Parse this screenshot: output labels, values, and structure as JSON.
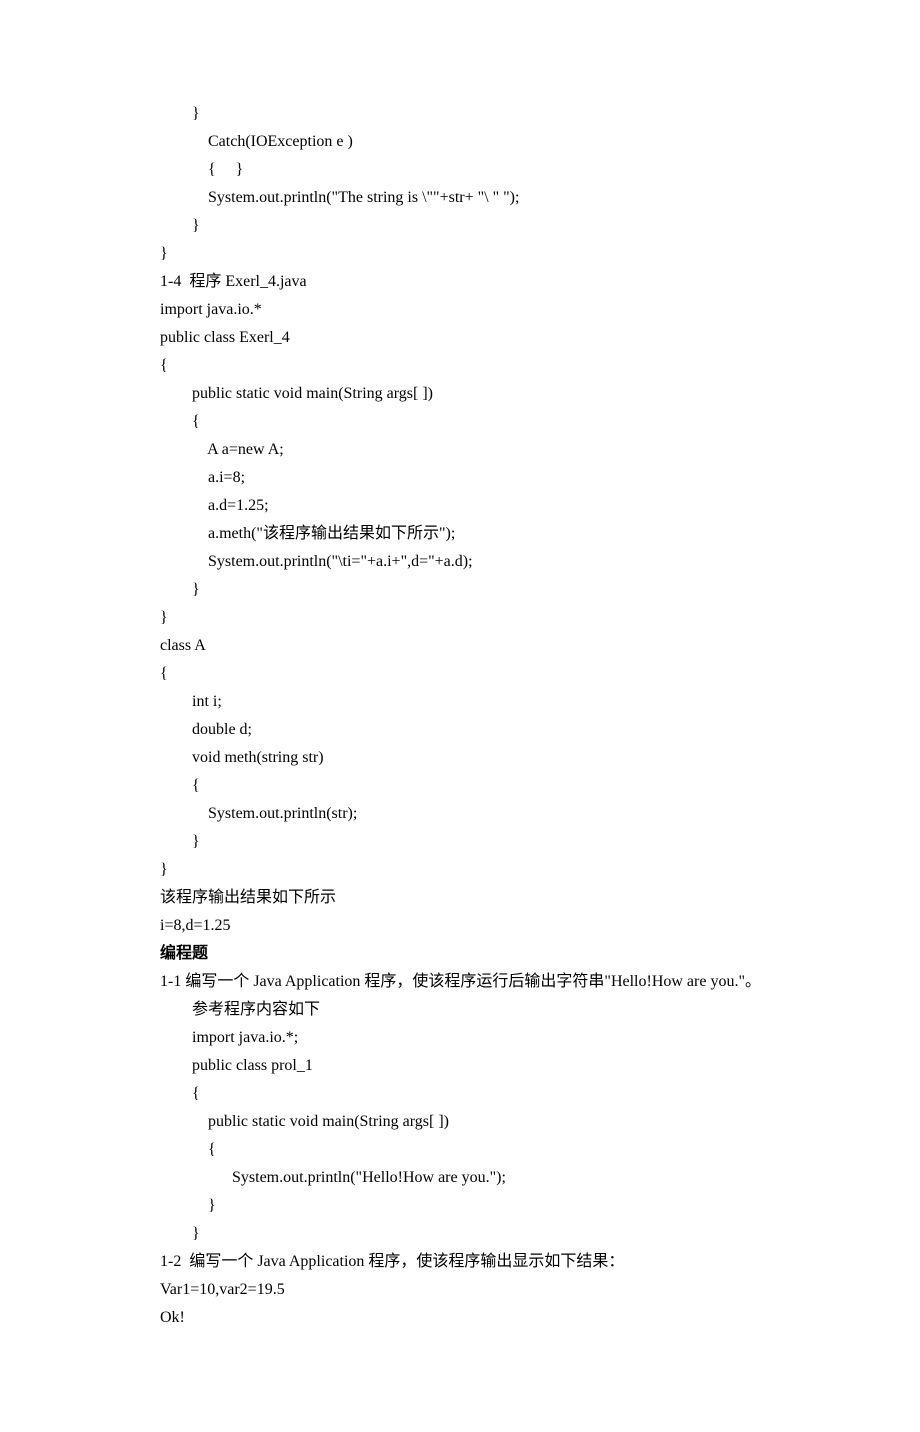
{
  "lines": [
    "        }",
    "            Catch(IOException e )",
    "            {     }",
    "            System.out.println(\"The string is \\\"\"+str+ \"\\ \" \");",
    "        }",
    "}",
    "1-4  程序 Exerl_4.java",
    "import java.io.*",
    "public class Exerl_4",
    "{",
    "        public static void main(String args[ ])",
    "        {",
    "            A a=new A;",
    "            a.i=8;",
    "            a.d=1.25;",
    "            a.meth(\"该程序输出结果如下所示\");",
    "            System.out.println(\"\\ti=\"+a.i+\",d=\"+a.d);",
    "        }",
    "}",
    "class A",
    "{",
    "        int i;",
    "        double d;",
    "        void meth(string str)",
    "        {",
    "            System.out.println(str);",
    "        }",
    "}",
    "该程序输出结果如下所示",
    "i=8,d=1.25"
  ],
  "heading": "编程题",
  "lines2": [
    "1-1 编写一个 Java Application 程序，使该程序运行后输出字符串\"Hello!How are you.\"。",
    "        参考程序内容如下",
    "        import java.io.*;",
    "        public class prol_1",
    "        {",
    "            public static void main(String args[ ])",
    "            {",
    "                  System.out.println(\"Hello!How are you.\");",
    "            }",
    "        }",
    "1-2  编写一个 Java Application 程序，使该程序输出显示如下结果：",
    "Var1=10,var2=19.5",
    "Ok!"
  ]
}
